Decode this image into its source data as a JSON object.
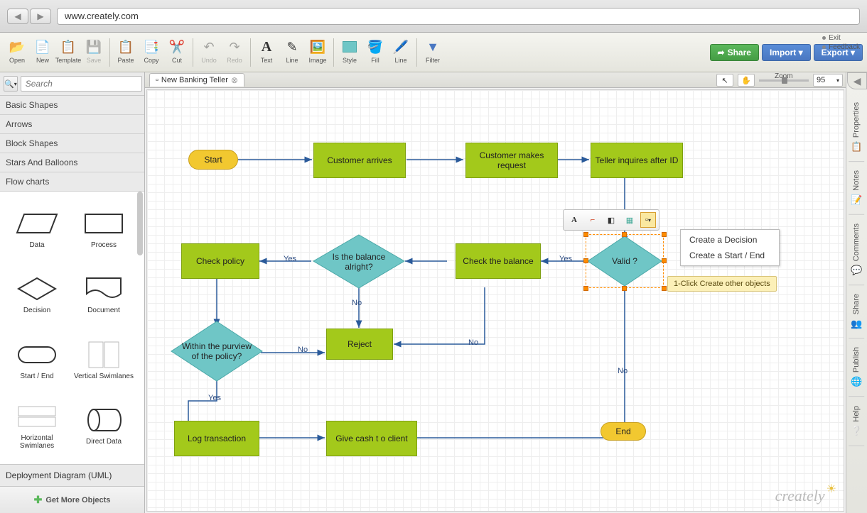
{
  "browser": {
    "url": "www.creately.com"
  },
  "toolbar": {
    "items": [
      "Open",
      "New",
      "Template",
      "Save",
      "Paste",
      "Copy",
      "Cut",
      "Undo",
      "Redo",
      "Text",
      "Line",
      "Image",
      "Style",
      "Fill",
      "Line",
      "Filter"
    ],
    "share": "Share",
    "import": "Import ▾",
    "export": "Export ▾"
  },
  "topLinks": {
    "exit": "Exit",
    "feedback": "Feedback"
  },
  "sidebar": {
    "searchPlaceholder": "Search",
    "categories": [
      "Basic Shapes",
      "Arrows",
      "Block Shapes",
      "Stars And Balloons",
      "Flow charts"
    ],
    "shapes": [
      "Data",
      "Process",
      "Decision",
      "Document",
      "Start / End",
      "Vertical Swimlanes",
      "Horizontal Swimlanes",
      "Direct Data"
    ],
    "footer": "Deployment Diagram (UML)",
    "getMore": "Get More Objects"
  },
  "tab": {
    "title": "New Banking Teller"
  },
  "zoom": {
    "label": "Zoom",
    "value": "95"
  },
  "nodes": {
    "start": "Start",
    "custArrives": "Customer arrives",
    "custRequest": "Customer makes request",
    "tellerInquires": "Teller inquires after ID",
    "checkPolicy": "Check policy",
    "balanceAlright": "Is the balance  alright?",
    "checkBalance": "Check the balance",
    "valid": "Valid  ?",
    "withinPolicy": "Within the purview  of the policy?",
    "reject": "Reject",
    "logTrans": "Log transaction",
    "giveCash": "Give cash t o client",
    "end": "End"
  },
  "edgeLabels": {
    "yes": "Yes",
    "no": "No"
  },
  "contextMenu": {
    "createDecision": "Create a Decision",
    "createStartEnd": "Create a Start / End"
  },
  "tooltip": "1-Click Create other objects",
  "panels": [
    "Properties",
    "Notes",
    "Comments",
    "Share",
    "Publish",
    "Help"
  ]
}
